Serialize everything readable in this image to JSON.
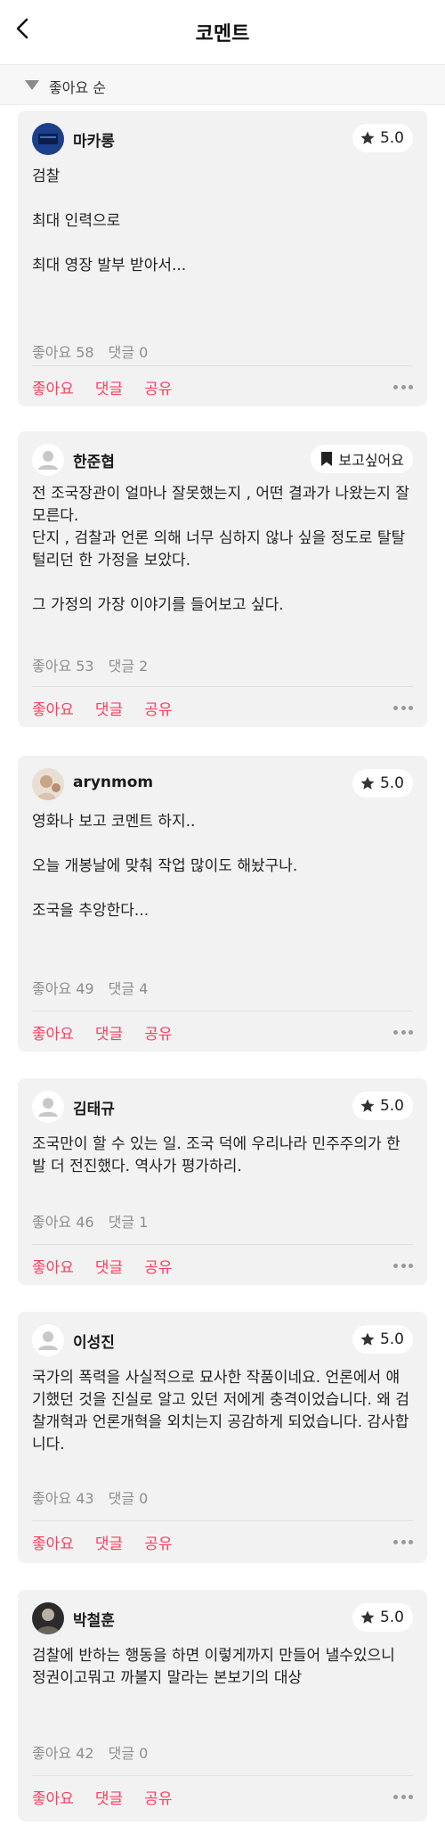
{
  "header": {
    "title": "코멘트"
  },
  "sort": {
    "label": "좋아요 순"
  },
  "actions": {
    "like": "좋아요",
    "reply": "댓글",
    "share": "공유"
  },
  "colors": {
    "accent": "#ff3d5e",
    "card_bg": "#f2f2f2"
  },
  "comments": [
    {
      "user": "마카롱",
      "badge_type": "rating",
      "rating": "5.0",
      "text": "검찰\n\n최대 인력으로\n\n최대 영장 발부 받아서...",
      "likes": "좋아요 58",
      "replies": "댓글 0"
    },
    {
      "user": "한준협",
      "badge_type": "wish",
      "badge_label": "보고싶어요",
      "text": "전 조국장관이 얼마나 잘못했는지 , 어떤 결과가 나왔는지 잘 모른다.\n단지 , 검찰과 언론 의해 너무 심하지 않나 싶을 정도로 탈탈 털리던 한 가정을 보았다.\n\n그 가정의 가장 이야기를 들어보고 싶다.",
      "likes": "좋아요 53",
      "replies": "댓글 2"
    },
    {
      "user": "arynmom",
      "badge_type": "rating",
      "rating": "5.0",
      "text": "영화나 보고 코멘트 하지..\n\n오늘 개봉날에 맞춰 작업 많이도 해놨구나.\n\n조국을 추앙한다...",
      "likes": "좋아요 49",
      "replies": "댓글 4"
    },
    {
      "user": "김태규",
      "badge_type": "rating",
      "rating": "5.0",
      "text": "조국만이 할 수 있는 일. 조국 덕에 우리나라 민주주의가 한발 더 전진했다. 역사가 평가하리.",
      "likes": "좋아요 46",
      "replies": "댓글 1"
    },
    {
      "user": "이성진",
      "badge_type": "rating",
      "rating": "5.0",
      "text": "국가의 폭력을 사실적으로 묘사한 작품이네요. 언론에서 얘기했던 것을 진실로 알고 있던 저에게 충격이었습니다. 왜 검찰개혁과 언론개혁을 외치는지 공감하게 되었습니다. 감사합니다.",
      "likes": "좋아요 43",
      "replies": "댓글 0"
    },
    {
      "user": "박철훈",
      "badge_type": "rating",
      "rating": "5.0",
      "text": "검찰에 반하는 행동을 하면 이렇게까지 만들어 낼수있으니 정권이고뭐고 까불지 말라는 본보기의 대상",
      "likes": "좋아요 42",
      "replies": "댓글 0"
    }
  ]
}
